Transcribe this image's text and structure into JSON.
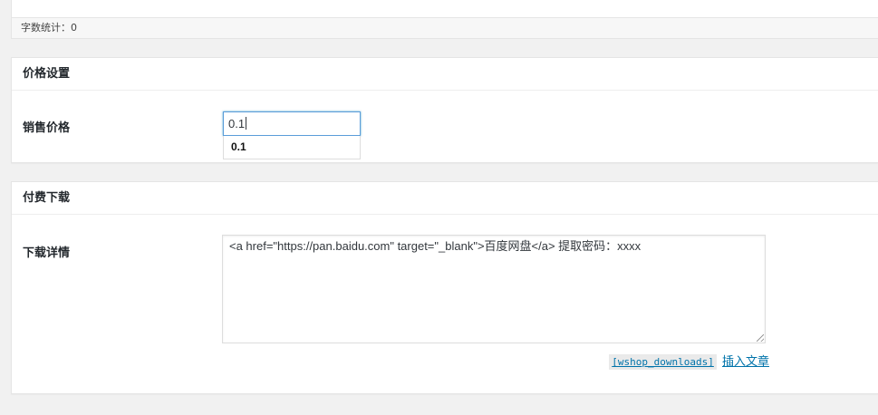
{
  "editor": {
    "word_count": "字数统计：0"
  },
  "price_box": {
    "title": "价格设置",
    "label": "销售价格",
    "input_value": "0.1",
    "suggestion": "0.1"
  },
  "download_box": {
    "title": "付费下载",
    "label": "下载详情",
    "textarea_value": "<a href=\"https://pan.baidu.com\" target=\"_blank\">百度网盘</a> 提取密码：xxxx",
    "shortcode": "[wshop_downloads]",
    "insert_link": "插入文章"
  },
  "colors": {
    "link": "#0073aa",
    "focus_border": "#5b9dd9",
    "background": "#f1f1f1"
  }
}
